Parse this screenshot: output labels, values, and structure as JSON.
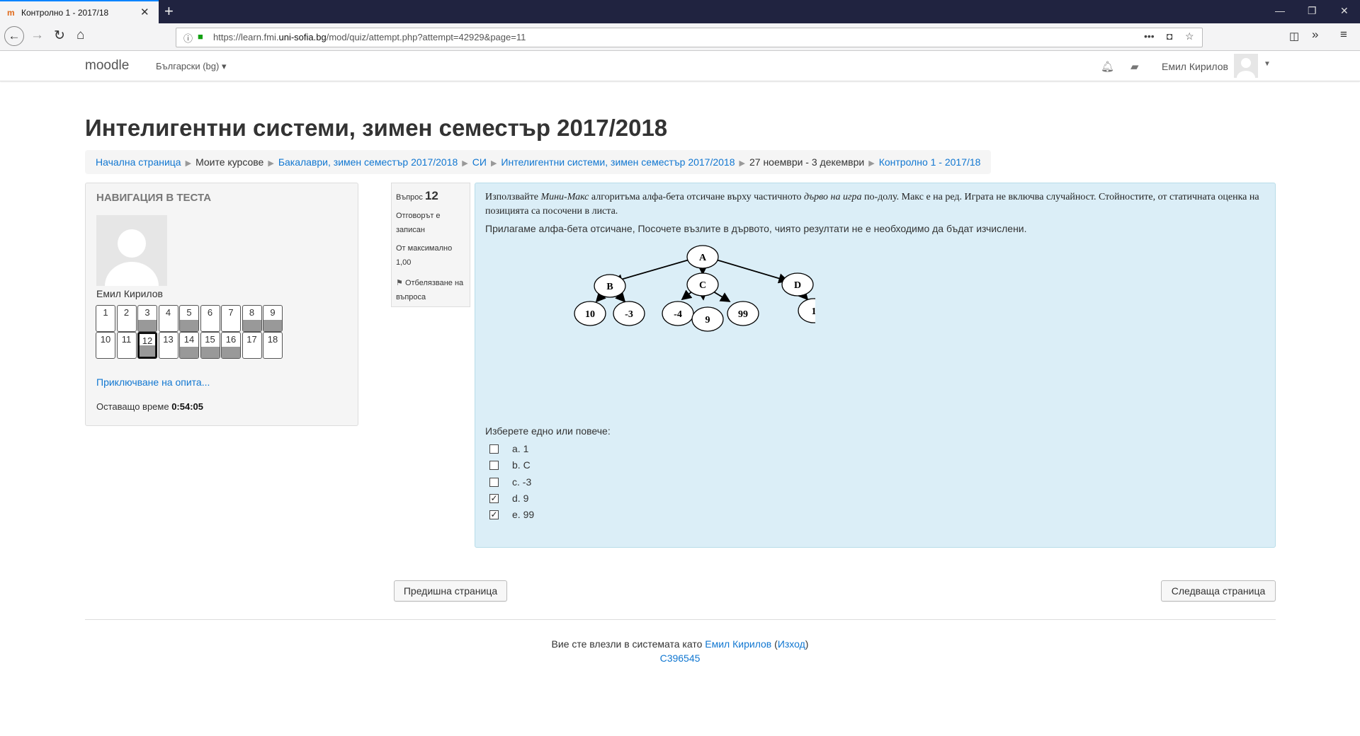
{
  "browser": {
    "tab_title": "Контролно 1 - 2017/18",
    "url_prefix": "https://learn.fmi.",
    "url_domain": "uni-sofia.bg",
    "url_path": "/mod/quiz/attempt.php?attempt=42929&page=11"
  },
  "header": {
    "brand": "moodle",
    "language": "Български (bg)",
    "user_name": "Емил Кирилов"
  },
  "page": {
    "title": "Интелигентни системи, зимен семестър 2017/2018",
    "breadcrumb": [
      "Начална страница",
      "Моите курсове",
      "Бакалаври, зимен семестър 2017/2018",
      "СИ",
      "Интелигентни системи, зимен семестър 2017/2018",
      "27 ноември - 3 декември",
      "Контролно 1 - 2017/18"
    ]
  },
  "nav_block": {
    "title": "НАВИГАЦИЯ В ТЕСТА",
    "user_name": "Емил Кирилов",
    "questions": [
      {
        "n": "1",
        "answered": false
      },
      {
        "n": "2",
        "answered": false
      },
      {
        "n": "3",
        "answered": true
      },
      {
        "n": "4",
        "answered": false
      },
      {
        "n": "5",
        "answered": true
      },
      {
        "n": "6",
        "answered": false
      },
      {
        "n": "7",
        "answered": false
      },
      {
        "n": "8",
        "answered": true
      },
      {
        "n": "9",
        "answered": true
      },
      {
        "n": "10",
        "answered": false
      },
      {
        "n": "11",
        "answered": false
      },
      {
        "n": "12",
        "answered": true,
        "current": true
      },
      {
        "n": "13",
        "answered": false
      },
      {
        "n": "14",
        "answered": true
      },
      {
        "n": "15",
        "answered": true
      },
      {
        "n": "16",
        "answered": true
      },
      {
        "n": "17",
        "answered": false
      },
      {
        "n": "18",
        "answered": false
      }
    ],
    "finish_link": "Приключване на опита...",
    "time_label": "Оставащо време",
    "time_value": "0:54:05"
  },
  "question_info": {
    "label": "Въпрос",
    "number": "12",
    "state": "Отговорът е записан",
    "mark": "От максимално 1,00",
    "flag": "Отбелязване на въпроса"
  },
  "question": {
    "text_part1": "Използвайте ",
    "text_em1": "Мини-Макс",
    "text_part2": " алгоритъма алфа-бета отсичане върху частичното ",
    "text_em2": "дърво на игра",
    "text_part3": " по-долу. Макс е на ред. Играта не включва случайност. Стойностите, от статичната оценка на позицията са посочени в листа.",
    "text2": "Прилагаме алфа-бета отсичане, Посочете възлите в дървото, чиято резултати не е необходимо да бъдат изчислени.",
    "tree_nodes": [
      "A",
      "B",
      "C",
      "D",
      "10",
      "-3",
      "-4",
      "9",
      "99",
      "1"
    ],
    "prompt": "Изберете едно или повече:",
    "answers": [
      {
        "label": "a. 1",
        "checked": false
      },
      {
        "label": "b. C",
        "checked": false
      },
      {
        "label": "c. -3",
        "checked": false
      },
      {
        "label": "d. 9",
        "checked": true
      },
      {
        "label": "e. 99",
        "checked": true
      }
    ]
  },
  "buttons": {
    "prev": "Предишна страница",
    "next": "Следваща страница"
  },
  "footer": {
    "logged_in_as": "Вие сте влезли в системата като",
    "user_link": "Емил Кирилов",
    "logout": "Изход",
    "session_id": "C396545"
  }
}
